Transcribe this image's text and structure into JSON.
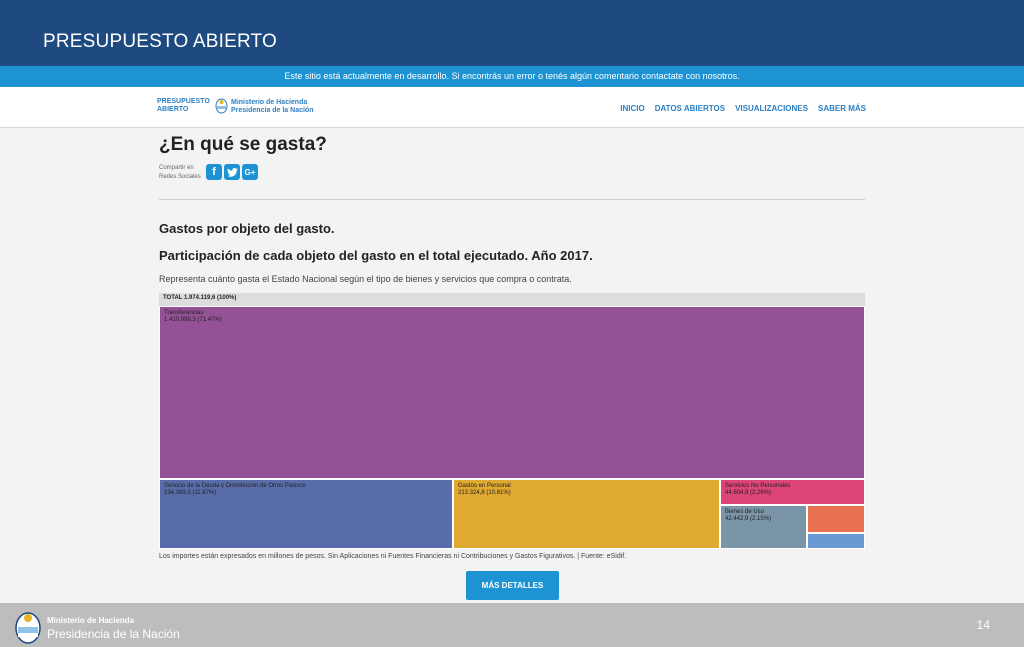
{
  "slide": {
    "title": "PRESUPUESTO ABIERTO",
    "page_number": "14",
    "footer_ministry": "Ministerio de Hacienda",
    "footer_presidencia": "Presidencia de la Nación"
  },
  "notice": "Este sitio está actualmente en desarrollo. Si encontrás un error o tenés algún comentario contactate con nosotros.",
  "nav": {
    "logo_line1": "PRESUPUESTO",
    "logo_line2": "ABIERTO",
    "ministry_line1": "Ministerio de Hacienda",
    "ministry_line2": "Presidencia de la Nación",
    "links": [
      "INICIO",
      "DATOS ABIERTOS",
      "VISUALIZACIONES",
      "SABER MÁS"
    ]
  },
  "page": {
    "heading": "¿En qué se gasta?",
    "share_label_1": "Compartir en",
    "share_label_2": "Redes Sociales",
    "share_icons": [
      "facebook-icon",
      "twitter-icon",
      "google-plus-icon"
    ],
    "section_title": "Gastos por objeto del gasto.",
    "section_subtitle": "Participación de cada objeto del gasto en el total ejecutado. Año 2017.",
    "description": "Representa cuánto gasta el Estado Nacional según el tipo de bienes y servicios que compra o contrata.",
    "footnote": "Los importes están expresados en millones de pesos. Sin Aplicaciones ni Fuentes Financieras ni Contribuciones y Gastos Figurativos. | Fuente: eSidif.",
    "details_button": "MÁS DETALLES"
  },
  "chart_data": {
    "type": "treemap",
    "total_label": "TOTAL 1.974.119,6 (100%)",
    "items": [
      {
        "name": "Transferencias",
        "value_label": "1.410.998,3 (71.47%)",
        "value": 1410998.3,
        "color": "#955196"
      },
      {
        "name": "Servicio de la Deuda y Disminución de Otros Pasivos",
        "value_label": "234.389,3 (11.87%)",
        "value": 234389.3,
        "color": "#586ca9"
      },
      {
        "name": "Gastos en Personal",
        "value_label": "213.324,8 (10.81%)",
        "value": 213324.8,
        "color": "#e0aa32"
      },
      {
        "name": "Servicios No Personales",
        "value_label": "44.604,9 (2.26%)",
        "value": 44604.9,
        "color": "#dd4478"
      },
      {
        "name": "Bienes de Uso",
        "value_label": "42.442,9 (2.15%)",
        "value": 42442.9,
        "color": "#7b95a8"
      },
      {
        "name": "",
        "value_label": "",
        "color": "#e6704f"
      },
      {
        "name": "",
        "value_label": "",
        "color": "#6a9ad4"
      }
    ]
  }
}
